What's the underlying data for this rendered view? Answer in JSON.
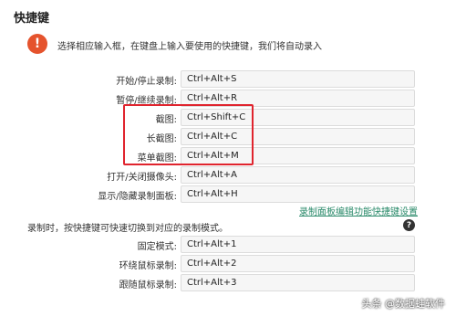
{
  "header": {
    "title": "快捷键"
  },
  "info": {
    "icon": "exclamation-icon",
    "glyph": "!",
    "text": "选择相应输入框，在键盘上输入要使用的快捷键，我们将自动录入",
    "accent_color": "#e5532d"
  },
  "shortcuts": [
    {
      "label": "开始/停止录制:",
      "value": "Ctrl+Alt+S"
    },
    {
      "label": "暂停/继续录制:",
      "value": "Ctrl+Alt+R"
    },
    {
      "label": "截图:",
      "value": "Ctrl+Shift+C"
    },
    {
      "label": "长截图:",
      "value": "Ctrl+Alt+C"
    },
    {
      "label": "菜单截图:",
      "value": "Ctrl+Alt+M"
    },
    {
      "label": "打开/关闭摄像头:",
      "value": "Ctrl+Alt+A"
    },
    {
      "label": "显示/隐藏录制面板:",
      "value": "Ctrl+Alt+H"
    }
  ],
  "settings_link": {
    "text": "录制面板编辑功能快捷键设置"
  },
  "mode_note": {
    "text": "录制时，按快捷键可快速切换到对应的录制模式。",
    "help_glyph": "?",
    "help_icon": "question-icon"
  },
  "mode_shortcuts": [
    {
      "label": "固定模式:",
      "value": "Ctrl+Alt+1"
    },
    {
      "label": "环绕鼠标录制:",
      "value": "Ctrl+Alt+2"
    },
    {
      "label": "跟随鼠标录制:",
      "value": "Ctrl+Alt+3"
    }
  ],
  "highlight_color": "#e0242e",
  "watermark": {
    "text": "头条 @数据蛙软件"
  }
}
